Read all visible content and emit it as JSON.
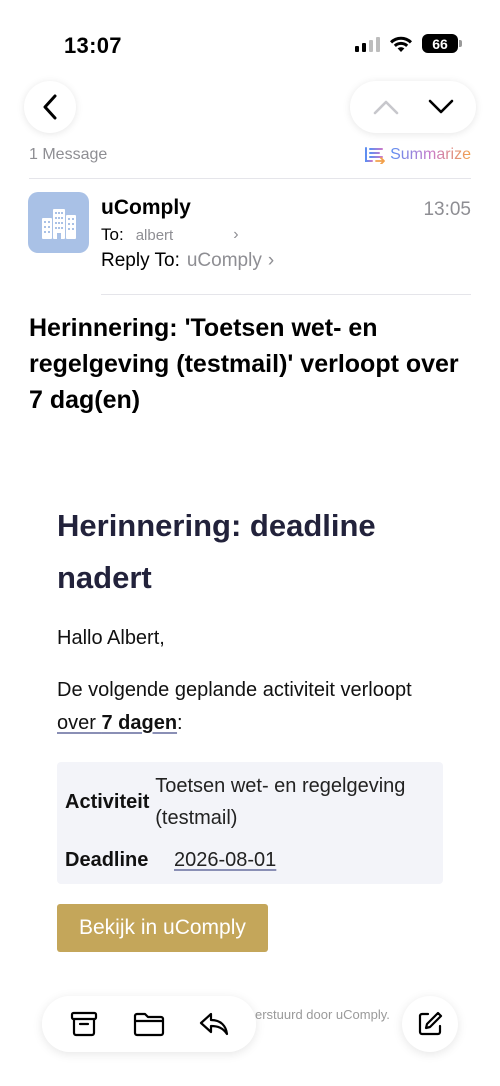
{
  "status_bar": {
    "time": "13:07",
    "battery": "66"
  },
  "thread": {
    "count_label": "1 Message",
    "summarize_label": "Summarize"
  },
  "header": {
    "sender": "uComply",
    "time": "13:05",
    "to_label": "To:",
    "to_name": "albert",
    "reply_to_label": "Reply To:",
    "reply_to_name": "uComply"
  },
  "subject": "Herinnering: 'Toetsen wet- en regelgeving (testmail)' verloopt over 7 dag(en)",
  "body": {
    "heading": "Herinnering: deadline nadert",
    "greeting": "Hallo Albert,",
    "intro_part1": "De volgende geplande activiteit verloopt ",
    "intro_link_plain": "over ",
    "intro_link_bold": "7 dagen",
    "intro_part2": ":",
    "details": [
      {
        "key": "Activiteit",
        "value": "Toetsen wet- en regelgeving (testmail)"
      },
      {
        "key": "Deadline",
        "value": "2026-08-01"
      }
    ],
    "cta_label": "Bekijk in uComply",
    "footer_text": "erstuurd door uComply."
  },
  "icons": {
    "back": "chevron-left-icon",
    "prev": "chevron-up-icon",
    "next": "chevron-down-icon",
    "archive": "archive-icon",
    "folder": "folder-icon",
    "reply": "reply-icon",
    "compose": "compose-icon"
  },
  "colors": {
    "accent_button": "#c4a65a",
    "avatar_bg": "#a9c1e6",
    "heading": "#22223b"
  }
}
